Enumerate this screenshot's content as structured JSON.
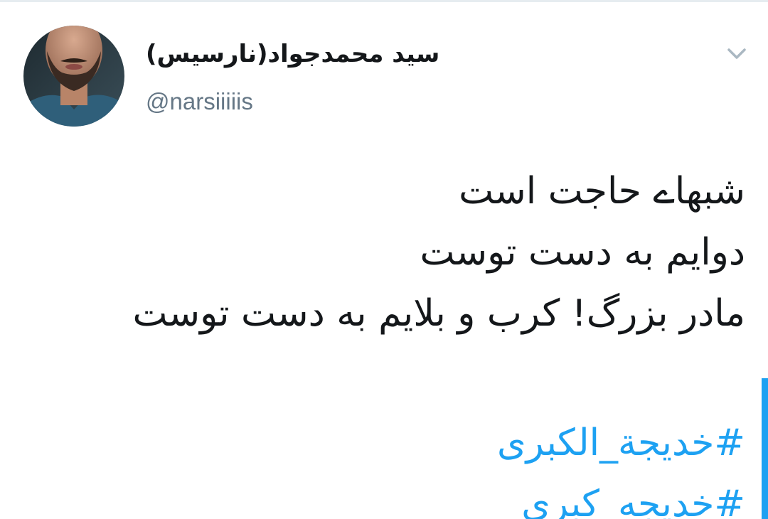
{
  "tweet": {
    "author": {
      "display_name": "سید محمدجواد(نارسیس)",
      "handle": "@narsiiiiis"
    },
    "menu_icon": "chevron-down-icon",
    "lines": [
      "شبهاے حاجت است",
      "دوایم به دست توست",
      "مادر بزرگ! کرب و بلایم به دست توست"
    ],
    "hashtags": [
      "#خدیجة_الکبری",
      "#خدیجه_کبری"
    ]
  },
  "colors": {
    "text": "#14171a",
    "secondary": "#657786",
    "link": "#1da1f2",
    "divider": "#e6ecf0"
  }
}
